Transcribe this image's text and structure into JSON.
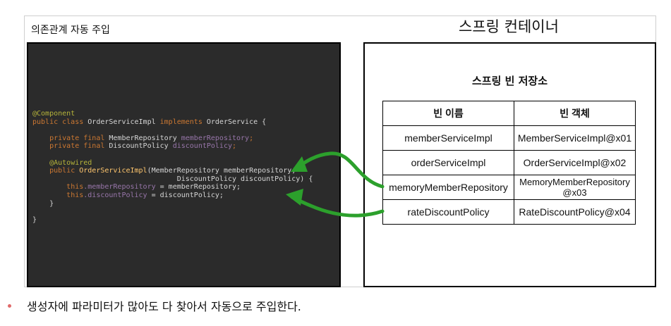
{
  "left_title": "의존관계 자동 주입",
  "right_title": "스프링 컨테이너",
  "code_lines": {
    "l1": "@Component",
    "l2_kw": "public class ",
    "l2_name": "OrderServiceImpl ",
    "l2_impl": "implements ",
    "l2_rest": "OrderService {",
    "l3_kw": "private final ",
    "l3_type": "MemberRepository ",
    "l3_field": "memberRepository",
    "l3_end": ";",
    "l4_kw": "private final ",
    "l4_type": "DiscountPolicy ",
    "l4_field": "discountPolicy",
    "l4_end": ";",
    "l5": "@Autowired",
    "l6_kw": "public ",
    "l6_name": "OrderServiceImpl",
    "l6_rest": "(MemberRepository memberRepository,",
    "l7": "DiscountPolicy discountPolicy) {",
    "l8_kw": "this",
    "l8_field": ".memberRepository",
    "l8_rest": " = memberRepository;",
    "l9_kw": "this",
    "l9_field": ".discountPolicy",
    "l9_rest": " = discountPolicy;",
    "l10": "}",
    "l11": "}"
  },
  "storage": {
    "title": "스프링 빈 저장소",
    "headers": [
      "빈 이름",
      "빈 객체"
    ],
    "rows": [
      [
        "memberServiceImpl",
        "MemberServiceImpl@x01"
      ],
      [
        "orderServiceImpl",
        "OrderServiceImpl@x02"
      ],
      [
        "memoryMemberRepository",
        "MemoryMemberRepository\n@x03"
      ],
      [
        "rateDiscountPolicy",
        "RateDiscountPolicy@x04"
      ]
    ]
  },
  "bullet": "생성자에 파라미터가 많아도 다 찾아서 자동으로 주입한다.",
  "colors": {
    "code_bg": "#2b2b2b",
    "annotation": "#b5b33a",
    "keyword": "#cc7832",
    "field": "#9876aa",
    "method": "#ffc66d",
    "arrow": "#2ca02c",
    "bullet": "#e06a6a"
  }
}
